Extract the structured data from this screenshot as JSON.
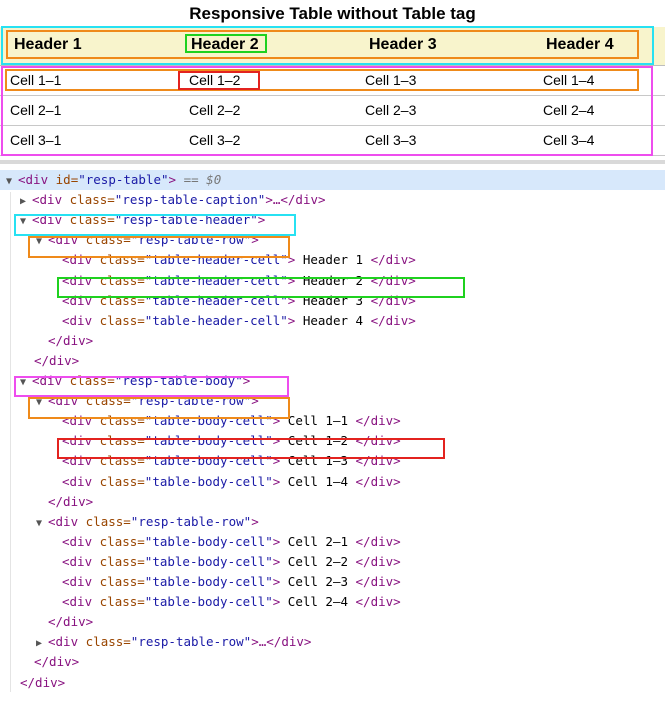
{
  "table": {
    "caption": "Responsive Table without Table tag",
    "headers": [
      "Header 1",
      "Header 2",
      "Header 3",
      "Header 4"
    ],
    "rows": [
      [
        "Cell 1–1",
        "Cell 1–2",
        "Cell 1–3",
        "Cell 1–4"
      ],
      [
        "Cell 2–1",
        "Cell 2–2",
        "Cell 2–3",
        "Cell 2–4"
      ],
      [
        "Cell 3–1",
        "Cell 3–2",
        "Cell 3–3",
        "Cell 3–4"
      ]
    ]
  },
  "devtools": {
    "lines": [
      {
        "toggle": "▼",
        "tag_open": "<div ",
        "attr": "id=",
        "value": "\"resp-table\"",
        "close": ">",
        "suffix": " == $0"
      },
      {
        "toggle": "▶",
        "tag_open": "<div ",
        "attr": "class=",
        "value": "\"resp-table-caption\"",
        "close": ">…</div>"
      },
      {
        "toggle": "▼",
        "tag_open": "<div ",
        "attr": "class=",
        "value": "\"resp-table-header\"",
        "close": ">"
      },
      {
        "toggle": "▼",
        "tag_open": "<div ",
        "attr": "class=",
        "value": "\"resp-table-row\"",
        "close": ">"
      },
      {
        "toggle": "",
        "tag_open": "<div ",
        "attr": "class=",
        "value": "\"table-header-cell\"",
        "close": ">",
        "text": " Header 1 ",
        "end": "</div>"
      },
      {
        "toggle": "",
        "tag_open": "<div ",
        "attr": "class=",
        "value": "\"table-header-cell\"",
        "close": ">",
        "text": " Header 2 ",
        "end": "</div>"
      },
      {
        "toggle": "",
        "tag_open": "<div ",
        "attr": "class=",
        "value": "\"table-header-cell\"",
        "close": ">",
        "text": " Header 3 ",
        "end": "</div>"
      },
      {
        "toggle": "",
        "tag_open": "<div ",
        "attr": "class=",
        "value": "\"table-header-cell\"",
        "close": ">",
        "text": " Header 4 ",
        "end": "</div>"
      },
      {
        "toggle": "",
        "tag_open": "</div>"
      },
      {
        "toggle": "",
        "tag_open": "</div>"
      },
      {
        "toggle": "▼",
        "tag_open": "<div ",
        "attr": "class=",
        "value": "\"resp-table-body\"",
        "close": ">"
      },
      {
        "toggle": "▼",
        "tag_open": "<div ",
        "attr": "class=",
        "value": "\"resp-table-row\"",
        "close": ">"
      },
      {
        "toggle": "",
        "tag_open": "<div ",
        "attr": "class=",
        "value": "\"table-body-cell\"",
        "close": ">",
        "text": " Cell 1–1 ",
        "end": "</div>"
      },
      {
        "toggle": "",
        "tag_open": "<div ",
        "attr": "class=",
        "value": "\"table-body-cell\"",
        "close": ">",
        "text": " Cell 1–2 ",
        "end": "</div>"
      },
      {
        "toggle": "",
        "tag_open": "<div ",
        "attr": "class=",
        "value": "\"table-body-cell\"",
        "close": ">",
        "text": " Cell 1–3 ",
        "end": "</div>"
      },
      {
        "toggle": "",
        "tag_open": "<div ",
        "attr": "class=",
        "value": "\"table-body-cell\"",
        "close": ">",
        "text": " Cell 1–4 ",
        "end": "</div>"
      },
      {
        "toggle": "",
        "tag_open": "</div>"
      },
      {
        "toggle": "▼",
        "tag_open": "<div ",
        "attr": "class=",
        "value": "\"resp-table-row\"",
        "close": ">"
      },
      {
        "toggle": "",
        "tag_open": "<div ",
        "attr": "class=",
        "value": "\"table-body-cell\"",
        "close": ">",
        "text": " Cell 2–1 ",
        "end": "</div>"
      },
      {
        "toggle": "",
        "tag_open": "<div ",
        "attr": "class=",
        "value": "\"table-body-cell\"",
        "close": ">",
        "text": " Cell 2–2 ",
        "end": "</div>"
      },
      {
        "toggle": "",
        "tag_open": "<div ",
        "attr": "class=",
        "value": "\"table-body-cell\"",
        "close": ">",
        "text": " Cell 2–3 ",
        "end": "</div>"
      },
      {
        "toggle": "",
        "tag_open": "<div ",
        "attr": "class=",
        "value": "\"table-body-cell\"",
        "close": ">",
        "text": " Cell 2–4 ",
        "end": "</div>"
      },
      {
        "toggle": "",
        "tag_open": "</div>"
      },
      {
        "toggle": "▶",
        "tag_open": "<div ",
        "attr": "class=",
        "value": "\"resp-table-row\"",
        "close": ">…</div>"
      },
      {
        "toggle": "",
        "tag_open": "</div>"
      },
      {
        "toggle": "",
        "tag_open": "</div>"
      }
    ]
  }
}
